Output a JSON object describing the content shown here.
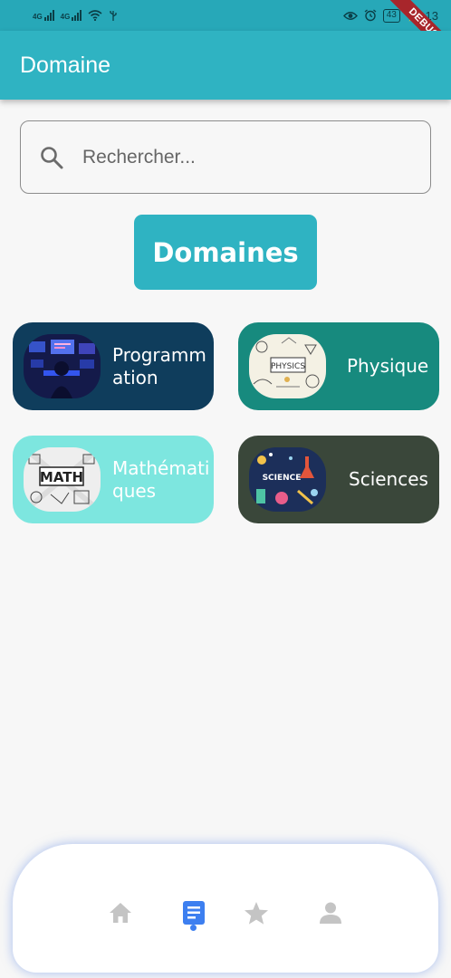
{
  "status_bar": {
    "signal_1_tag": "4G",
    "signal_2_tag": "4G",
    "battery": "43",
    "time": "13"
  },
  "debug_label": "DEBUG",
  "app_bar": {
    "title": "Domaine"
  },
  "search": {
    "placeholder": "Rechercher..."
  },
  "section_button": "Domaines",
  "domains": [
    {
      "label": "Programmation",
      "color": "#0f3d5c",
      "icon": "programming-image"
    },
    {
      "label": "Physique",
      "color": "#178a7e",
      "icon": "physics-image"
    },
    {
      "label": "Mathématiques",
      "color": "#7de6df",
      "icon": "math-image"
    },
    {
      "label": "Sciences",
      "color": "#3a473a",
      "icon": "science-image"
    }
  ],
  "bottom_nav": {
    "items": [
      "home-icon",
      "list-icon",
      "star-icon",
      "person-icon"
    ],
    "active": "list-icon",
    "active_color": "#3d7ff0",
    "inactive_color": "#c4c4c4"
  }
}
